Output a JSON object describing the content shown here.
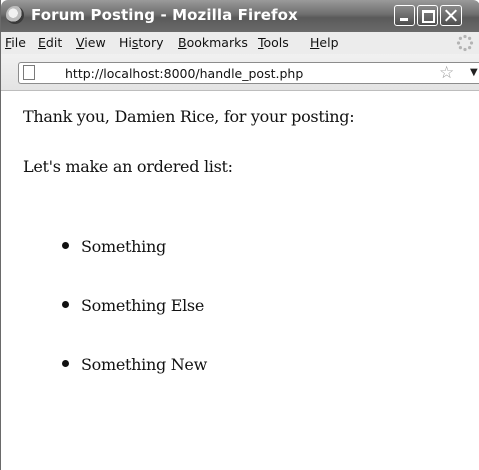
{
  "window": {
    "title": "Forum Posting - Mozilla Firefox"
  },
  "menu": {
    "items": [
      {
        "accel": "F",
        "rest": "ile"
      },
      {
        "accel": "E",
        "rest": "dit"
      },
      {
        "accel": "V",
        "rest": "iew"
      },
      {
        "pre": "Hi",
        "accel": "s",
        "rest": "tory"
      },
      {
        "accel": "B",
        "rest": "ookmarks"
      },
      {
        "accel": "T",
        "rest": "ools"
      },
      {
        "accel": "H",
        "rest": "elp"
      }
    ]
  },
  "address_bar": {
    "url": "http://localhost:8000/handle_post.php"
  },
  "page": {
    "thank_you": "Thank you, Damien Rice, for your posting:",
    "intro": "Let's make an ordered list:",
    "list_items": [
      "Something",
      "Something Else",
      "Something New"
    ]
  },
  "icons": {
    "app": "firefox-globe-icon",
    "page": "page-icon",
    "bookmark": "star-icon",
    "dropdown": "chevron-down-icon",
    "throbber": "throbber-icon"
  }
}
